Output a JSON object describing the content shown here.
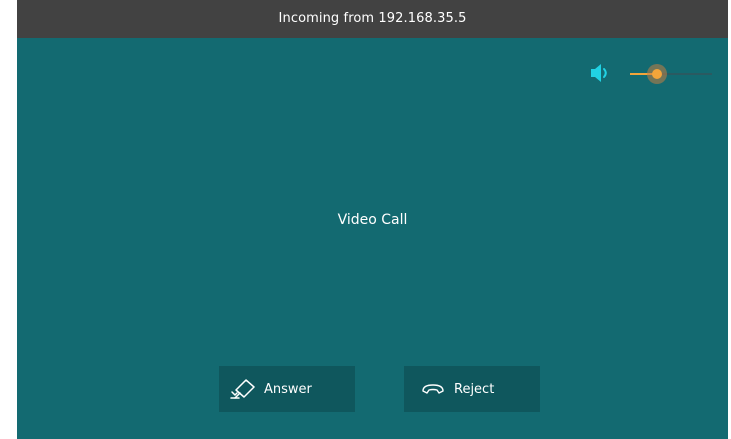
{
  "window": {
    "title": "Incoming from 192.168.35.5"
  },
  "volume": {
    "icon": "speaker-icon",
    "level": 0.33,
    "accent_color": "#f3a53a",
    "icon_color": "#21d2e3"
  },
  "main": {
    "label": "Video Call"
  },
  "actions": {
    "answer_label": "Answer",
    "answer_icon": "camera-icon",
    "reject_label": "Reject",
    "reject_icon": "phone-hangup-icon"
  },
  "colors": {
    "background": "#136a71",
    "titlebar": "#424242",
    "button": "#0f575d"
  }
}
